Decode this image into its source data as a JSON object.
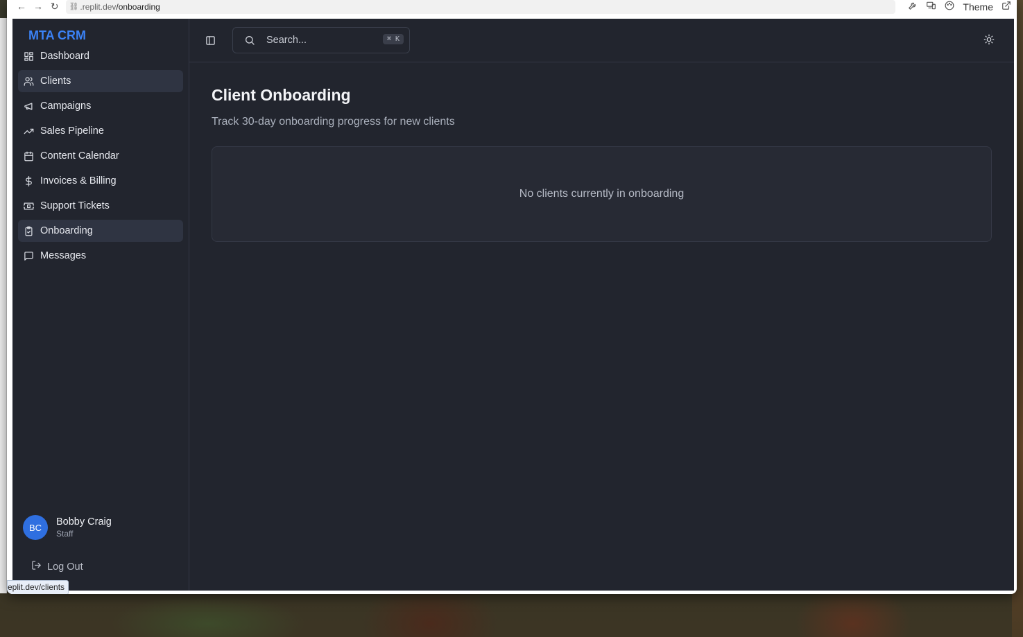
{
  "browser": {
    "url_host": ".replit.dev",
    "url_path": "/onboarding",
    "theme_label": "Theme",
    "status_url": "eplit.dev/clients"
  },
  "sidebar": {
    "brand": "MTA CRM",
    "items": [
      {
        "label": "Dashboard",
        "icon": "dashboard-icon"
      },
      {
        "label": "Clients",
        "icon": "users-icon"
      },
      {
        "label": "Campaigns",
        "icon": "megaphone-icon"
      },
      {
        "label": "Sales Pipeline",
        "icon": "trending-up-icon"
      },
      {
        "label": "Content Calendar",
        "icon": "calendar-icon"
      },
      {
        "label": "Invoices & Billing",
        "icon": "dollar-icon"
      },
      {
        "label": "Support Tickets",
        "icon": "ticket-icon"
      },
      {
        "label": "Onboarding",
        "icon": "clipboard-check-icon"
      },
      {
        "label": "Messages",
        "icon": "message-icon"
      }
    ],
    "user": {
      "initials": "BC",
      "name": "Bobby Craig",
      "role": "Staff"
    },
    "logout_label": "Log Out"
  },
  "header": {
    "search_placeholder": "Search...",
    "shortcut": "⌘ K"
  },
  "main": {
    "title": "Client Onboarding",
    "subtitle": "Track 30-day onboarding progress for new clients",
    "empty_message": "No clients currently in onboarding"
  },
  "colors": {
    "accent": "#3b82f6",
    "background": "#22252e",
    "card": "#272a34"
  }
}
